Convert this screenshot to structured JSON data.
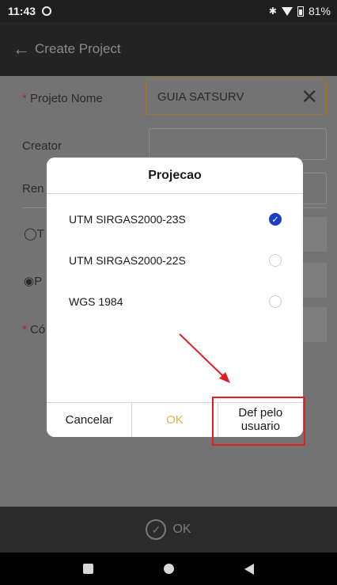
{
  "status_bar": {
    "time": "11:43",
    "battery": "81%"
  },
  "app_bar": {
    "title": "Create Project"
  },
  "form": {
    "name_label": "Projeto Nome",
    "name_value": "GUIA SATSURV",
    "creator_label": "Creator",
    "remark_label_partial": "Ren",
    "radio_t_partial": "T",
    "radio_p_partial": "P",
    "code_label_partial": "Có"
  },
  "dialog": {
    "title": "Projecao",
    "options": [
      {
        "label": "UTM SIRGAS2000-23S",
        "selected": true
      },
      {
        "label": "UTM SIRGAS2000-22S",
        "selected": false
      },
      {
        "label": "WGS 1984",
        "selected": false
      }
    ],
    "cancel_label": "Cancelar",
    "ok_label": "OK",
    "user_def_label": "Def pelo usuario"
  },
  "bottom_bar": {
    "ok_label": "OK"
  },
  "colors": {
    "accent_ok": "#e8b04a",
    "radio_selected": "#1a3fc4",
    "highlight": "#e02020"
  }
}
